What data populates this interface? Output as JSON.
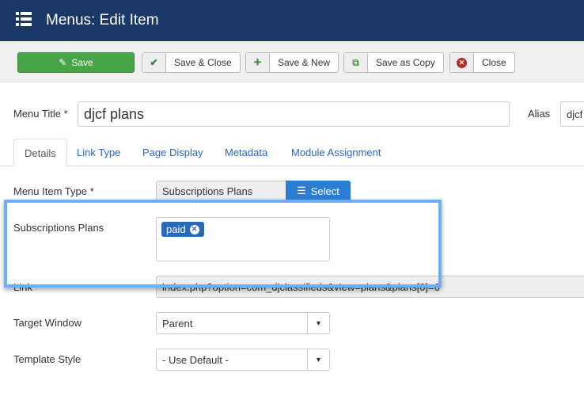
{
  "header": {
    "title": "Menus: Edit Item",
    "icon": "list-icon"
  },
  "toolbar": {
    "save": "Save",
    "save_close": "Save & Close",
    "save_new": "Save & New",
    "save_copy": "Save as Copy",
    "close": "Close"
  },
  "form": {
    "menu_title_label": "Menu Title *",
    "menu_title_value": "djcf plans",
    "alias_label": "Alias",
    "alias_value": "djcf"
  },
  "tabs": [
    "Details",
    "Link Type",
    "Page Display",
    "Metadata",
    "Module Assignment"
  ],
  "fields": {
    "menu_item_type_label": "Menu Item Type *",
    "menu_item_type_value": "Subscriptions Plans",
    "select_label": "Select",
    "plans_label": "Subscriptions Plans",
    "plans_tags": [
      "paid"
    ],
    "link_label": "Link",
    "link_value": "index.php?option=com_djclassifieds&view=plans&plans[0]=6",
    "target_label": "Target Window",
    "target_value": "Parent",
    "template_label": "Template Style",
    "template_value": "- Use Default -"
  },
  "colors": {
    "header": "#1a3867",
    "save": "#47a447",
    "accent": "#2a7fd4",
    "highlight": "#6eb0f7"
  }
}
